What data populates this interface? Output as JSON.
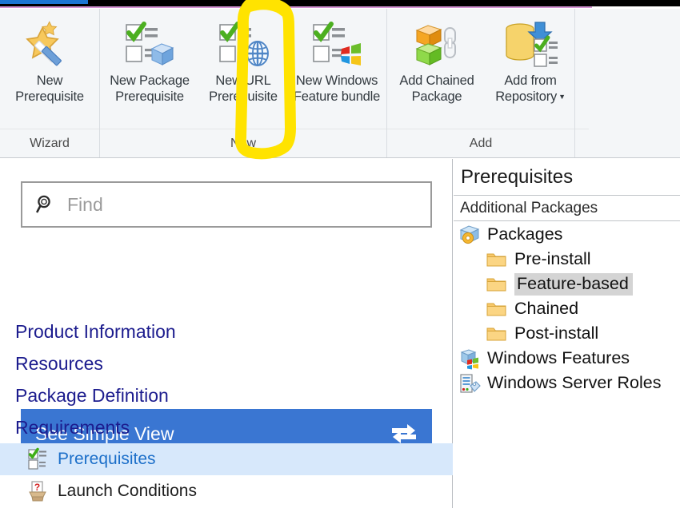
{
  "ribbon": {
    "groups": [
      {
        "name": "wizard",
        "label": "Wizard",
        "buttons": [
          {
            "id": "new-prerequisite",
            "icon": "magic-wand-icon",
            "line1": "New",
            "line2": "Prerequisite",
            "caret": ""
          }
        ]
      },
      {
        "name": "new",
        "label": "New",
        "buttons": [
          {
            "id": "new-package-prerequisite",
            "icon": "checkbox-list-cube-icon",
            "line1": "New Package",
            "line2": "Prerequisite",
            "caret": ""
          },
          {
            "id": "new-url-prerequisite",
            "icon": "checkbox-list-globe-icon",
            "line1": "New URL",
            "line2": "Prerequisite",
            "caret": ""
          },
          {
            "id": "new-windows-feature-bundle",
            "icon": "checkbox-list-windows-icon",
            "line1": "New Windows",
            "line2": "Feature bundle",
            "caret": ""
          }
        ]
      },
      {
        "name": "add",
        "label": "Add",
        "buttons": [
          {
            "id": "add-chained-package",
            "icon": "chained-boxes-icon",
            "line1": "Add Chained",
            "line2": "Package",
            "caret": ""
          },
          {
            "id": "add-from-repository",
            "icon": "database-download-icon",
            "line1": "Add from",
            "line2": "Repository",
            "caret": "▼"
          }
        ]
      }
    ]
  },
  "annotation": {
    "type": "highlighter-rectangle",
    "color": "#ffe300",
    "targets": "new-url-prerequisite"
  },
  "left_pane": {
    "search": {
      "placeholder": "Find",
      "value": "",
      "icon": "search-icon"
    },
    "simple_view_button": {
      "label": "See Simple View",
      "icon": "swap-arrows-icon",
      "color": "#3a76d2"
    },
    "nav": [
      {
        "id": "product-information",
        "label": "Product Information",
        "level": 0,
        "selected": false,
        "icon": ""
      },
      {
        "id": "resources",
        "label": "Resources",
        "level": 0,
        "selected": false,
        "icon": ""
      },
      {
        "id": "package-definition",
        "label": "Package Definition",
        "level": 0,
        "selected": false,
        "icon": ""
      },
      {
        "id": "requirements",
        "label": "Requirements",
        "level": 0,
        "selected": false,
        "icon": ""
      },
      {
        "id": "prerequisites",
        "label": "Prerequisites",
        "level": 1,
        "selected": true,
        "icon": "checkbox-list-icon"
      },
      {
        "id": "launch-conditions",
        "label": "Launch Conditions",
        "level": 1,
        "selected": false,
        "icon": "question-box-icon"
      }
    ]
  },
  "right_pane": {
    "title": "Prerequisites",
    "subtitle": "Additional Packages",
    "tree": [
      {
        "id": "packages",
        "label": "Packages",
        "level": 0,
        "icon": "package-gear-icon",
        "selected": false
      },
      {
        "id": "pre-install",
        "label": "Pre-install",
        "level": 1,
        "icon": "folder-icon",
        "selected": false
      },
      {
        "id": "feature-based",
        "label": "Feature-based",
        "level": 1,
        "icon": "folder-icon",
        "selected": true
      },
      {
        "id": "chained",
        "label": "Chained",
        "level": 1,
        "icon": "folder-icon",
        "selected": false
      },
      {
        "id": "post-install",
        "label": "Post-install",
        "level": 1,
        "icon": "folder-icon",
        "selected": false
      },
      {
        "id": "windows-features",
        "label": "Windows Features",
        "level": 0,
        "icon": "windows-features-icon",
        "selected": false
      },
      {
        "id": "windows-server-roles",
        "label": "Windows Server Roles",
        "level": 0,
        "icon": "server-roles-icon",
        "selected": false
      }
    ]
  },
  "colors": {
    "accent_blue": "#3a76d2",
    "link_navy": "#1c1c8e",
    "selection_blue": "#d7e8fb",
    "marker_yellow": "#ffe300",
    "ribbon_bg": "#f4f6f8"
  }
}
